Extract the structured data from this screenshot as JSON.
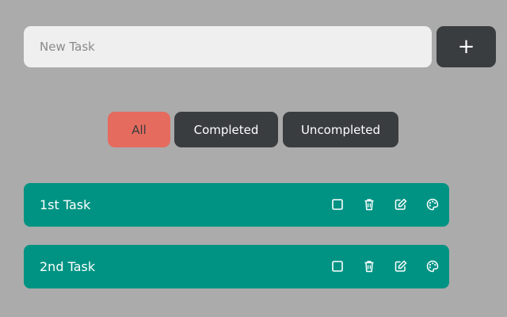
{
  "new_task": {
    "placeholder": "New Task",
    "value": "",
    "add_label": "+"
  },
  "filters": [
    {
      "label": "All",
      "active": true
    },
    {
      "label": "Completed",
      "active": false
    },
    {
      "label": "Uncompleted",
      "active": false
    }
  ],
  "tasks": [
    {
      "label": "1st Task",
      "completed": false
    },
    {
      "label": "2nd Task",
      "completed": false
    }
  ],
  "task_action_icons": [
    "checkbox-icon",
    "trash-icon",
    "edit-icon",
    "palette-icon"
  ],
  "colors": {
    "background": "#ababab",
    "input_bg": "#efefef",
    "dark_button": "#3a3d40",
    "active_filter": "#e56b5e",
    "task_bg": "#009383",
    "text_light": "#ffffff"
  }
}
